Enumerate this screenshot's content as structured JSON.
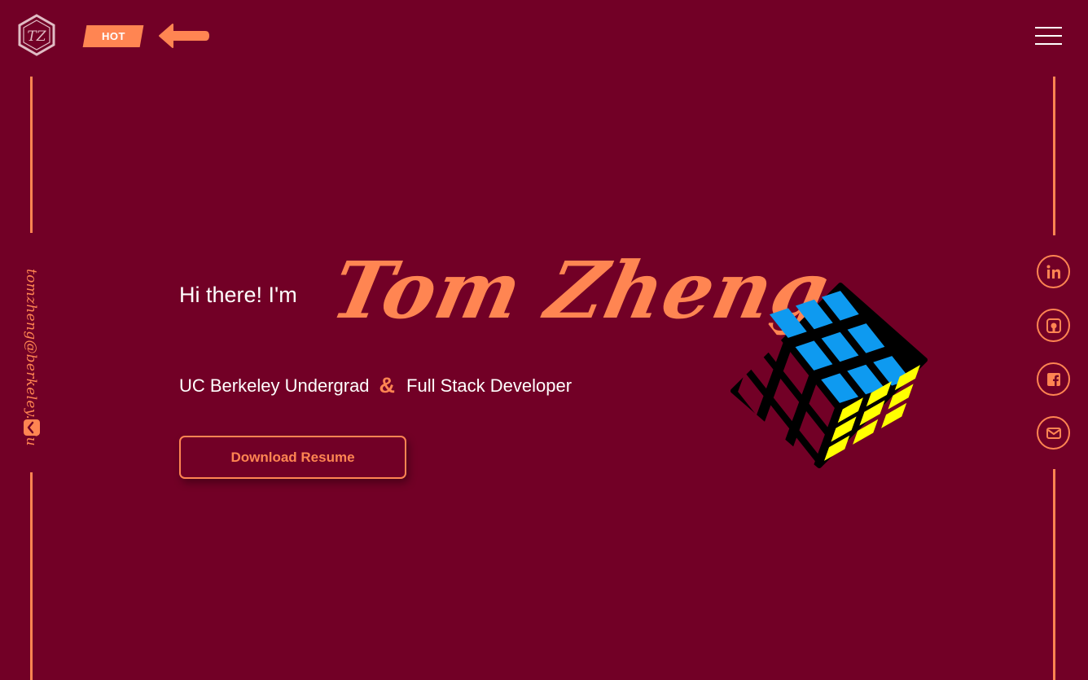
{
  "header": {
    "logo_text": "TZ",
    "hot_label": "HOT",
    "menu_icon": "hamburger-menu-icon"
  },
  "sidebar_left": {
    "email": "tomzheng@berkeley.edu",
    "email_icon": "email-diamond-icon"
  },
  "hero": {
    "greeting": "Hi there! I'm",
    "name": "Tom Zheng",
    "subtitle_left": "UC Berkeley Undergrad",
    "ampersand": "&",
    "subtitle_right": "Full Stack Developer",
    "resume_button": "Download Resume",
    "graphic": "rubiks-cube"
  },
  "social": [
    {
      "icon": "linkedin-icon"
    },
    {
      "icon": "github-icon"
    },
    {
      "icon": "facebook-icon"
    },
    {
      "icon": "mail-icon"
    }
  ],
  "colors": {
    "background": "#720026",
    "accent": "#ff8552",
    "text": "#ffffff",
    "cube_top": "#0e9af0",
    "cube_side": "#ffff00",
    "cube_body": "#000000"
  }
}
